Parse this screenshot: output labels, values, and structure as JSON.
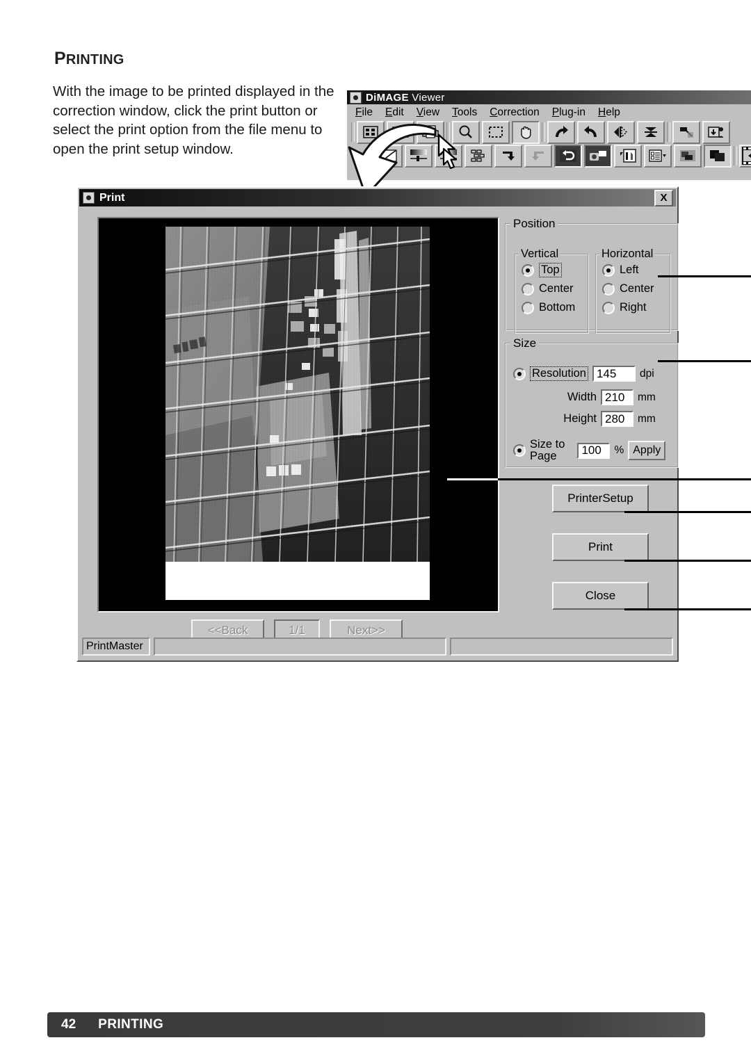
{
  "page": {
    "title": "PRINTING",
    "body_text": "With the image to be printed displayed in the correction window, click the print button or select the print option from the file menu to open the print setup window.",
    "footer_page_number": "42",
    "footer_section": "PRINTING"
  },
  "viewer": {
    "title": "DiMAGE Viewer",
    "title_bold": "DiMAGE",
    "title_thin": "Viewer",
    "menu": [
      {
        "label": "File",
        "accel": "F"
      },
      {
        "label": "Edit",
        "accel": "E"
      },
      {
        "label": "View",
        "accel": "V"
      },
      {
        "label": "Tools",
        "accel": "T"
      },
      {
        "label": "Correction",
        "accel": "C"
      },
      {
        "label": "Plug-in",
        "accel": "P"
      },
      {
        "label": "Help",
        "accel": "H"
      }
    ],
    "toolbar_row1": [
      "thumbnail-grid-icon",
      "save-icon",
      "print-icon",
      "magnify-icon",
      "crop-select-icon",
      "grab-hand-icon",
      "rotate-left-icon",
      "rotate-right-icon",
      "flip-horizontal-icon",
      "flip-vertical-icon",
      "undo-all-icon",
      "batch-save-icon"
    ],
    "toolbar_row2": [
      "tone-curve-icon",
      "brightness-contrast-icon",
      "hue-saturation-icon",
      "variation-icon",
      "undo-icon",
      "redo-icon",
      "reset-icon",
      "snapshot-icon",
      "histogram-icon",
      "image-info-icon",
      "transparency-icon",
      "compare-icon",
      "filmstrip-icon"
    ]
  },
  "dialog": {
    "title": "Print",
    "close_label": "X",
    "position": {
      "legend": "Position",
      "vertical": {
        "legend": "Vertical",
        "options": [
          "Top",
          "Center",
          "Bottom"
        ],
        "selected": "Top"
      },
      "horizontal": {
        "legend": "Horizontal",
        "options": [
          "Left",
          "Center",
          "Right"
        ],
        "selected": "Left"
      }
    },
    "size": {
      "legend": "Size",
      "resolution_label": "Resolution",
      "resolution_value": "145",
      "resolution_unit": "dpi",
      "width_label": "Width",
      "width_value": "210",
      "width_unit": "mm",
      "height_label": "Height",
      "height_value": "280",
      "height_unit": "mm",
      "size_to_page_label_line1": "Size to",
      "size_to_page_label_line2": "Page",
      "size_to_page_value": "100",
      "percent_unit": "%",
      "apply_label": "Apply",
      "selected_mode": "Resolution"
    },
    "buttons": {
      "printer_setup": "PrinterSetup",
      "print": "Print",
      "close": "Close"
    },
    "navigation": {
      "back": "<<Back",
      "page_indicator": "1/1",
      "next": "Next>>"
    },
    "status_bar": {
      "label": "PrintMaster",
      "field1": "",
      "field2": ""
    }
  },
  "colors": {
    "dialog_face": "#c0c0c0",
    "titlebar_dark": "#0d0d0d",
    "footer_bar": "#3a3a3a",
    "text": "#000000",
    "preview_background": "#000000"
  }
}
